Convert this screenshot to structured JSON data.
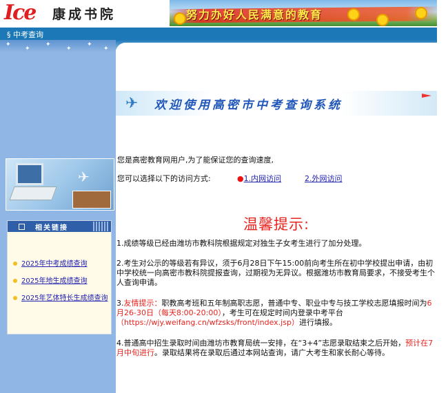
{
  "header": {
    "logo_mark": "Ice",
    "logo_text": "康成书院",
    "banner_text": "努力办好人民满意的教育",
    "banner_flower_count": 4
  },
  "nav": {
    "section_label": "§ 中考查询"
  },
  "sidebar": {
    "links_title": "相关链接",
    "links": [
      {
        "label": "2025年中考成绩查询"
      },
      {
        "label": "2025年地生成绩查询"
      },
      {
        "label": "2025年艺体特长生成绩查询"
      }
    ]
  },
  "main": {
    "welcome_title": "欢迎使用高密市中考查询系统",
    "intro_line1": "您是高密教育网用户,为了能保证您的查询速度,",
    "intro_line2": "您可以选择以下的访问方式:",
    "access_options": [
      {
        "bullet": "●",
        "label": "1.内网访问"
      },
      {
        "label": "2.外网访问"
      }
    ],
    "tips_title": "温馨提示:",
    "notice1": "1.成绩等级已经由潍坊市教科院根据规定对独生子女考生进行了加分处理。",
    "notice2": "2.考生对公示的等级若有异议，须于6月28日下午15:00前向考生所在初中学校提出申请，由初中学校统一向高密市教科院提报查询，过期视为无异议。根据潍坊市教育局要求，不接受考生个人查询申请。",
    "notice3": {
      "prefix": "3.",
      "highlight1": "友情提示：",
      "text1": "职教高考班和五年制高职志愿，普通中专、职业中专与技工学校志愿填报时间为",
      "highlight2": "6月26-30日（每天8:00-20:00）",
      "text2": "，考生可在规定时间内登录中考平台",
      "highlight3": "（https://wjy.weifang.cn/wfzsks/front/index.jsp）",
      "text3": "进行填报。"
    },
    "notice4": {
      "text1": "4.普通高中招生录取时间由潍坊市教育局统一安排，在“3+4”志愿录取结束之后开始，",
      "highlight": "预计在7月中旬进行",
      "text2": "。录取结果将在录取后通过本网站查询，请广大考生和家长耐心等待。"
    }
  },
  "colors": {
    "accent_blue": "#1d78b8",
    "sidebar_blue": "#8fb6e4",
    "link_blue": "#2020b0",
    "highlight_red": "#e8231e"
  }
}
